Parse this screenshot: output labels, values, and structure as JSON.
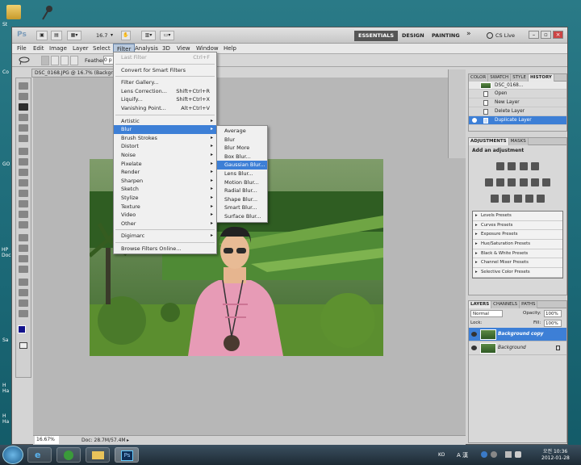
{
  "desktop": {
    "icons": [
      {
        "name": "folder-icon",
        "label": "St",
        "color": "#d9b44a"
      },
      {
        "name": "microphone-icon",
        "label": "",
        "color": "#444"
      }
    ],
    "left_labels": [
      "Co",
      "GO",
      "HP Doc",
      "Sa",
      "H Ha",
      "H Ha"
    ]
  },
  "titlebar": {
    "app": "Ps",
    "zoom": "16.7",
    "workspaces": [
      "ESSENTIALS",
      "DESIGN",
      "PAINTING"
    ],
    "more": "»",
    "cslive": "CS Live"
  },
  "menubar": [
    "File",
    "Edit",
    "Image",
    "Layer",
    "Select",
    "Filter",
    "Analysis",
    "3D",
    "View",
    "Window",
    "Help"
  ],
  "options": {
    "feather_label": "Feather:",
    "feather_value": "0 p"
  },
  "document": {
    "tab": "DSC_0168.JPG @ 16.7% (Backgro",
    "zoom": "16.67%",
    "docsize": "Doc: 28.7M/57.4M"
  },
  "filter_menu": {
    "items": [
      {
        "label": "Last Filter",
        "shortcut": "Ctrl+F",
        "state": "disabled"
      },
      {
        "sep": true
      },
      {
        "label": "Convert for Smart Filters"
      },
      {
        "sep": true
      },
      {
        "label": "Filter Gallery..."
      },
      {
        "label": "Lens Correction...",
        "shortcut": "Shift+Ctrl+R"
      },
      {
        "label": "Liquify...",
        "shortcut": "Shift+Ctrl+X"
      },
      {
        "label": "Vanishing Point...",
        "shortcut": "Alt+Ctrl+V"
      },
      {
        "sep": true
      },
      {
        "label": "Artistic",
        "sub": true
      },
      {
        "label": "Blur",
        "sub": true,
        "state": "selected"
      },
      {
        "label": "Brush Strokes",
        "sub": true
      },
      {
        "label": "Distort",
        "sub": true
      },
      {
        "label": "Noise",
        "sub": true
      },
      {
        "label": "Pixelate",
        "sub": true
      },
      {
        "label": "Render",
        "sub": true
      },
      {
        "label": "Sharpen",
        "sub": true
      },
      {
        "label": "Sketch",
        "sub": true
      },
      {
        "label": "Stylize",
        "sub": true
      },
      {
        "label": "Texture",
        "sub": true
      },
      {
        "label": "Video",
        "sub": true
      },
      {
        "label": "Other",
        "sub": true
      },
      {
        "sep": true
      },
      {
        "label": "Digimarc",
        "sub": true
      },
      {
        "sep": true
      },
      {
        "label": "Browse Filters Online..."
      }
    ]
  },
  "blur_menu": {
    "items": [
      "Average",
      "Blur",
      "Blur More",
      "Box Blur...",
      "Gaussian Blur...",
      "Lens Blur...",
      "Motion Blur...",
      "Radial Blur...",
      "Shape Blur...",
      "Smart Blur...",
      "Surface Blur..."
    ],
    "selected": "Gaussian Blur..."
  },
  "history_panel": {
    "tabs": [
      "COLOR",
      "SWATCH",
      "STYLE",
      "HISTORY"
    ],
    "top_label": "DSC_0168...",
    "items": [
      "Open",
      "New Layer",
      "Delete Layer",
      "Duplicate Layer"
    ],
    "selected": "Duplicate Layer"
  },
  "adjustments_panel": {
    "tabs": [
      "ADJUSTMENTS",
      "MASKS"
    ],
    "heading": "Add an adjustment",
    "presets": [
      "Levels Presets",
      "Curves Presets",
      "Exposure Presets",
      "Hue/Saturation Presets",
      "Black & White Presets",
      "Channel Mixer Presets",
      "Selective Color Presets"
    ]
  },
  "layers_panel": {
    "tabs": [
      "LAYERS",
      "CHANNELS",
      "PATHS"
    ],
    "blend": "Normal",
    "opacity_label": "Opacity:",
    "opacity": "100%",
    "lock_label": "Lock:",
    "fill_label": "Fill:",
    "fill": "100%",
    "layers": [
      {
        "name": "Background copy",
        "selected": true
      },
      {
        "name": "Background",
        "selected": false
      }
    ]
  },
  "taskbar": {
    "lang": "KO",
    "time": "오전 10:36",
    "date": "2012-01-28",
    "ime": "A 漢"
  },
  "colors": {
    "accent": "#3d7fd6",
    "desktop": "#1f6a78"
  }
}
